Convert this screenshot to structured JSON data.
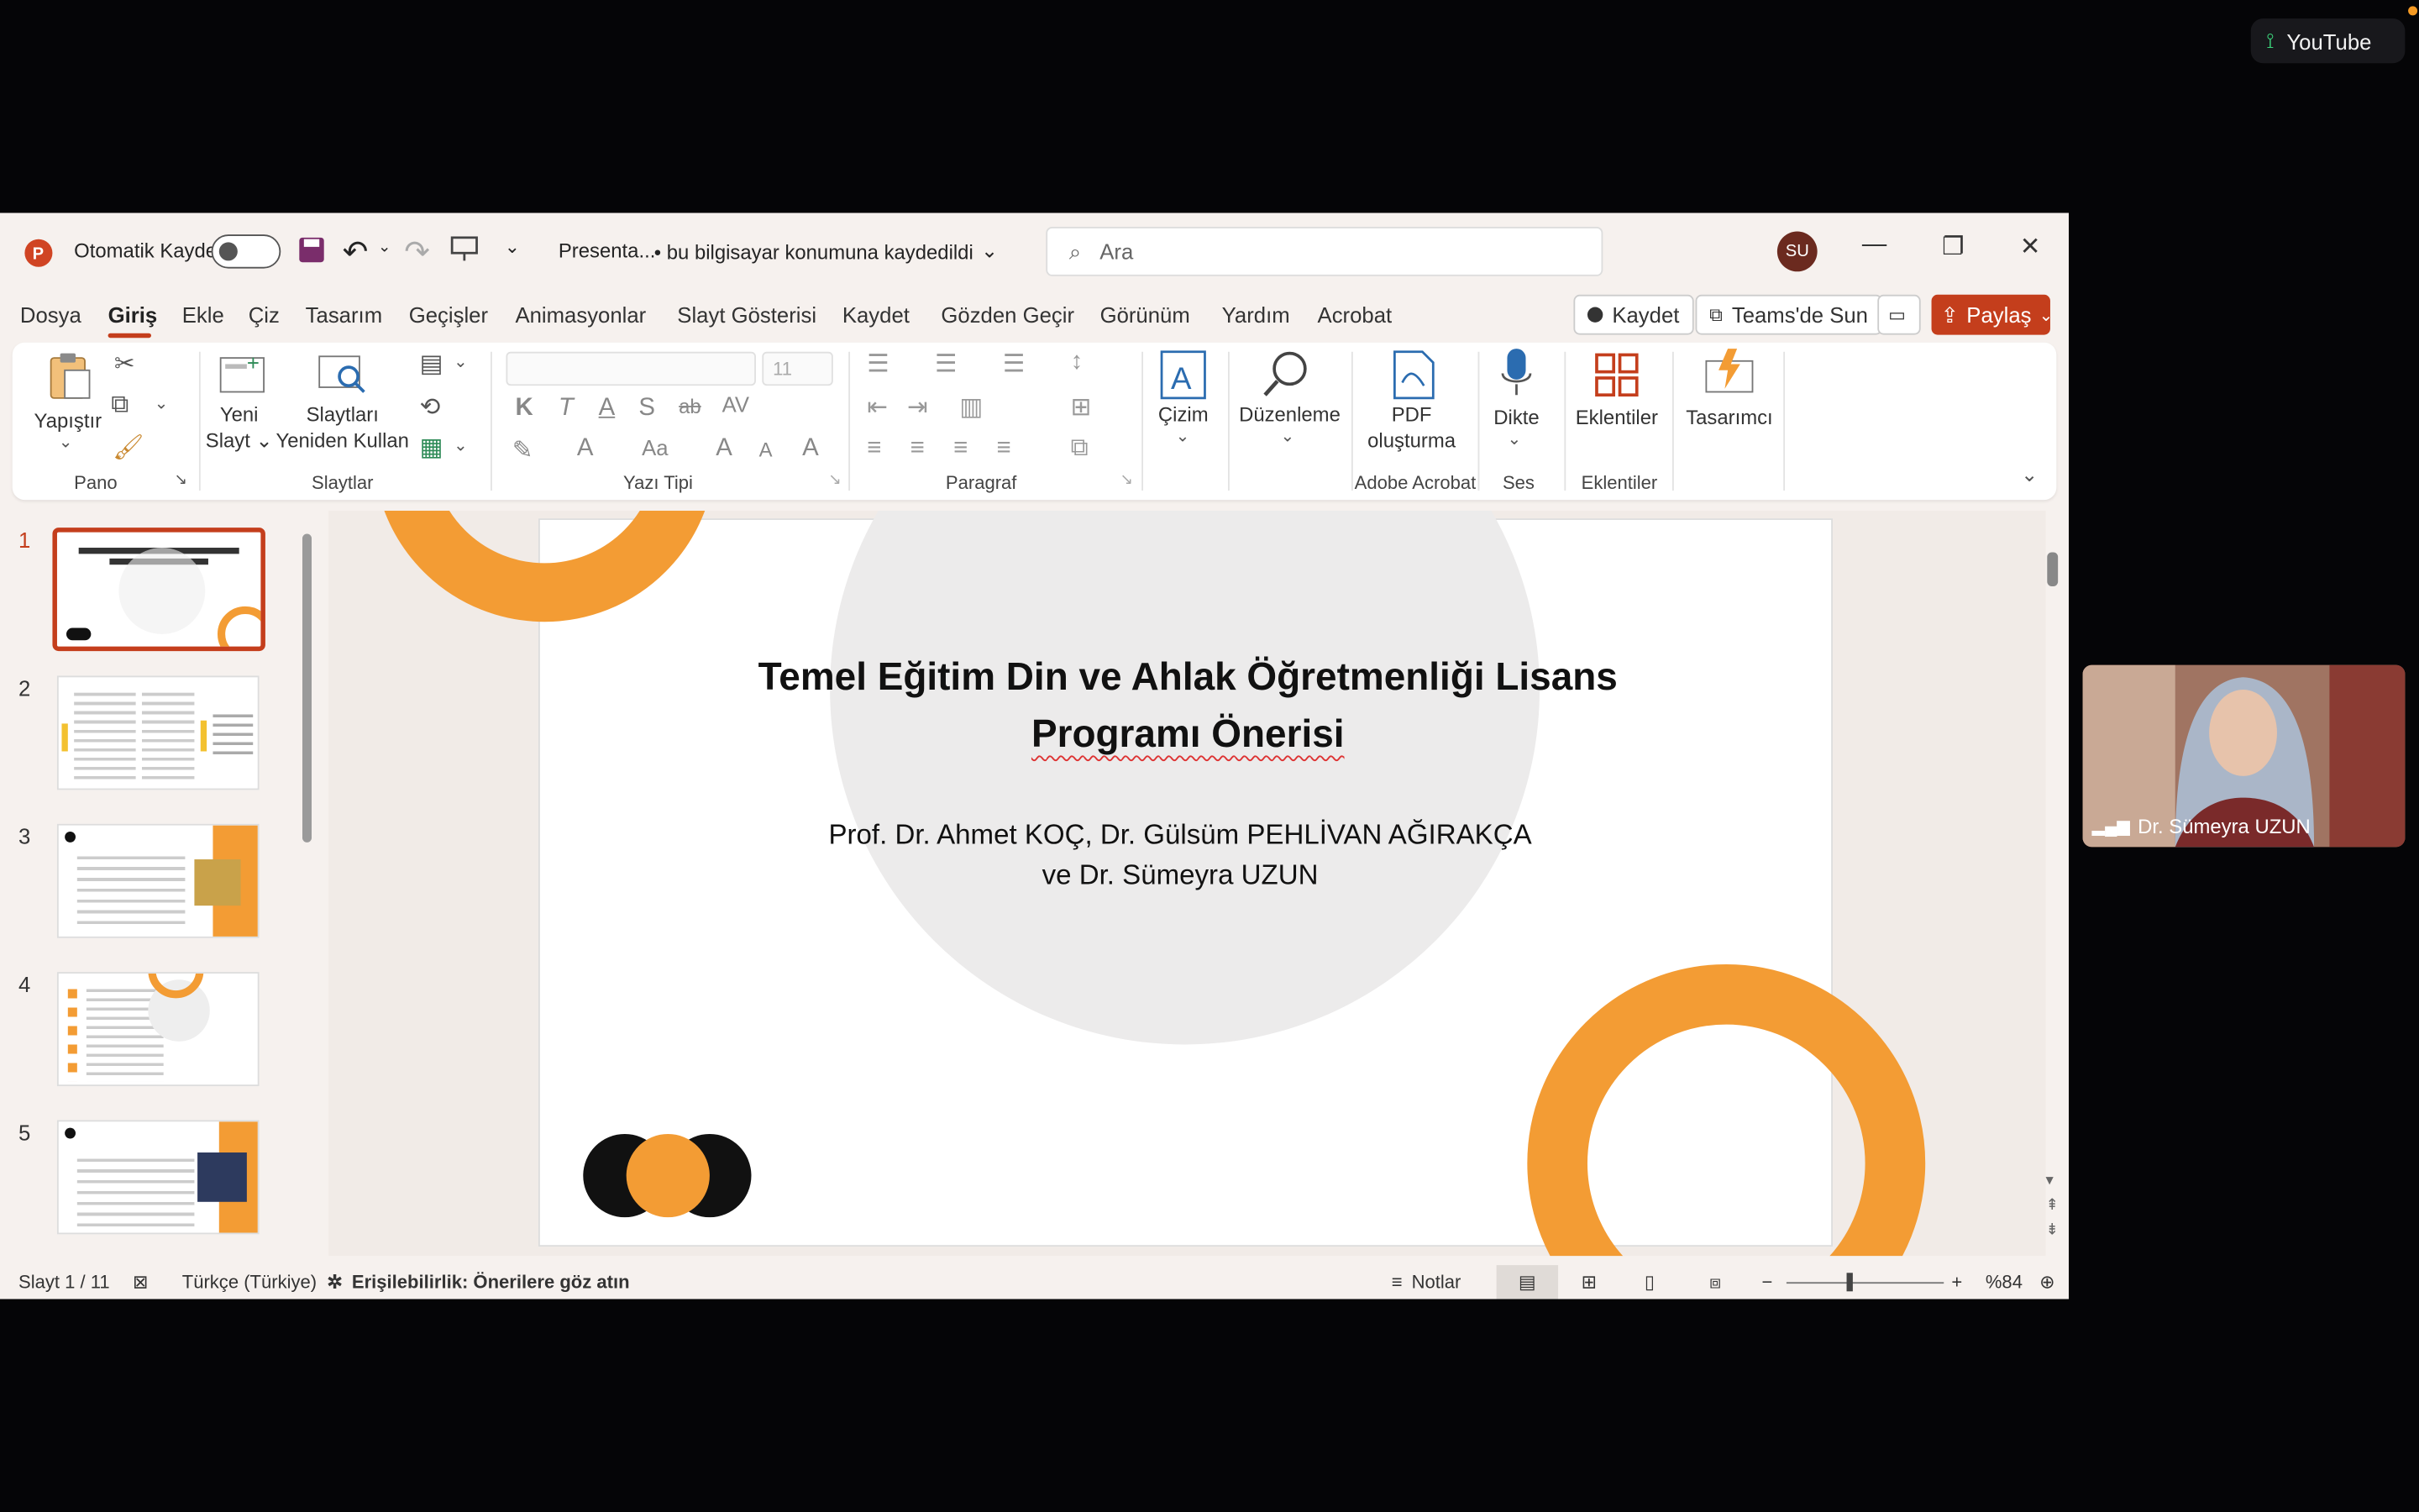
{
  "top_right": {
    "app_label": "YouTube"
  },
  "titlebar": {
    "autosave_label": "Otomatik Kaydet",
    "doc_name": "Presenta...",
    "save_status": "• bu bilgisayar konumuna kaydedildi",
    "search_placeholder": "Ara",
    "avatar_initials": "SU"
  },
  "menu": {
    "tabs": [
      "Dosya",
      "Giriş",
      "Ekle",
      "Çiz",
      "Tasarım",
      "Geçişler",
      "Animasyonlar",
      "Slayt Gösterisi",
      "Kaydet",
      "Gözden Geçir",
      "Görünüm",
      "Yardım",
      "Acrobat"
    ],
    "record_label": "Kaydet",
    "teams_label": "Teams'de Sun",
    "share_label": "Paylaş"
  },
  "ribbon": {
    "paste": "Yapıştır",
    "new_slide_1": "Yeni",
    "new_slide_2": "Slayt",
    "reuse_1": "Slaytları",
    "reuse_2": "Yeniden Kullan",
    "font_size": "11",
    "draw": "Çizim",
    "edit": "Düzenleme",
    "pdf_1": "PDF",
    "pdf_2": "oluşturma",
    "dictate": "Dikte",
    "addins": "Eklentiler",
    "designer": "Tasarımcı",
    "groups": {
      "clipboard": "Pano",
      "slides": "Slaytlar",
      "font": "Yazı Tipi",
      "paragraph": "Paragraf",
      "acrobat": "Adobe Acrobat",
      "voice": "Ses",
      "addins": "Eklentiler"
    }
  },
  "thumbnails": [
    "1",
    "2",
    "3",
    "4",
    "5"
  ],
  "slide": {
    "title_line1": "Temel Eğitim Din ve Ahlak Öğretmenliği Lisans",
    "title_line2": "Programı Önerisi",
    "authors_line1": "Prof. Dr. Ahmet KOÇ, Dr. Gülsüm PEHLİVAN AĞIRAKÇA",
    "authors_line2": "ve Dr. Sümeyra UZUN"
  },
  "status": {
    "slide_count": "Slayt 1 / 11",
    "language": "Türkçe (Türkiye)",
    "accessibility": "Erişilebilirlik: Önerilere göz atın",
    "notes": "Notlar",
    "zoom": "%84"
  },
  "participant": {
    "name": "Dr. Sümeyra UZUN"
  },
  "colors": {
    "accent": "#c43e1c",
    "slide_orange": "#f39c34"
  }
}
